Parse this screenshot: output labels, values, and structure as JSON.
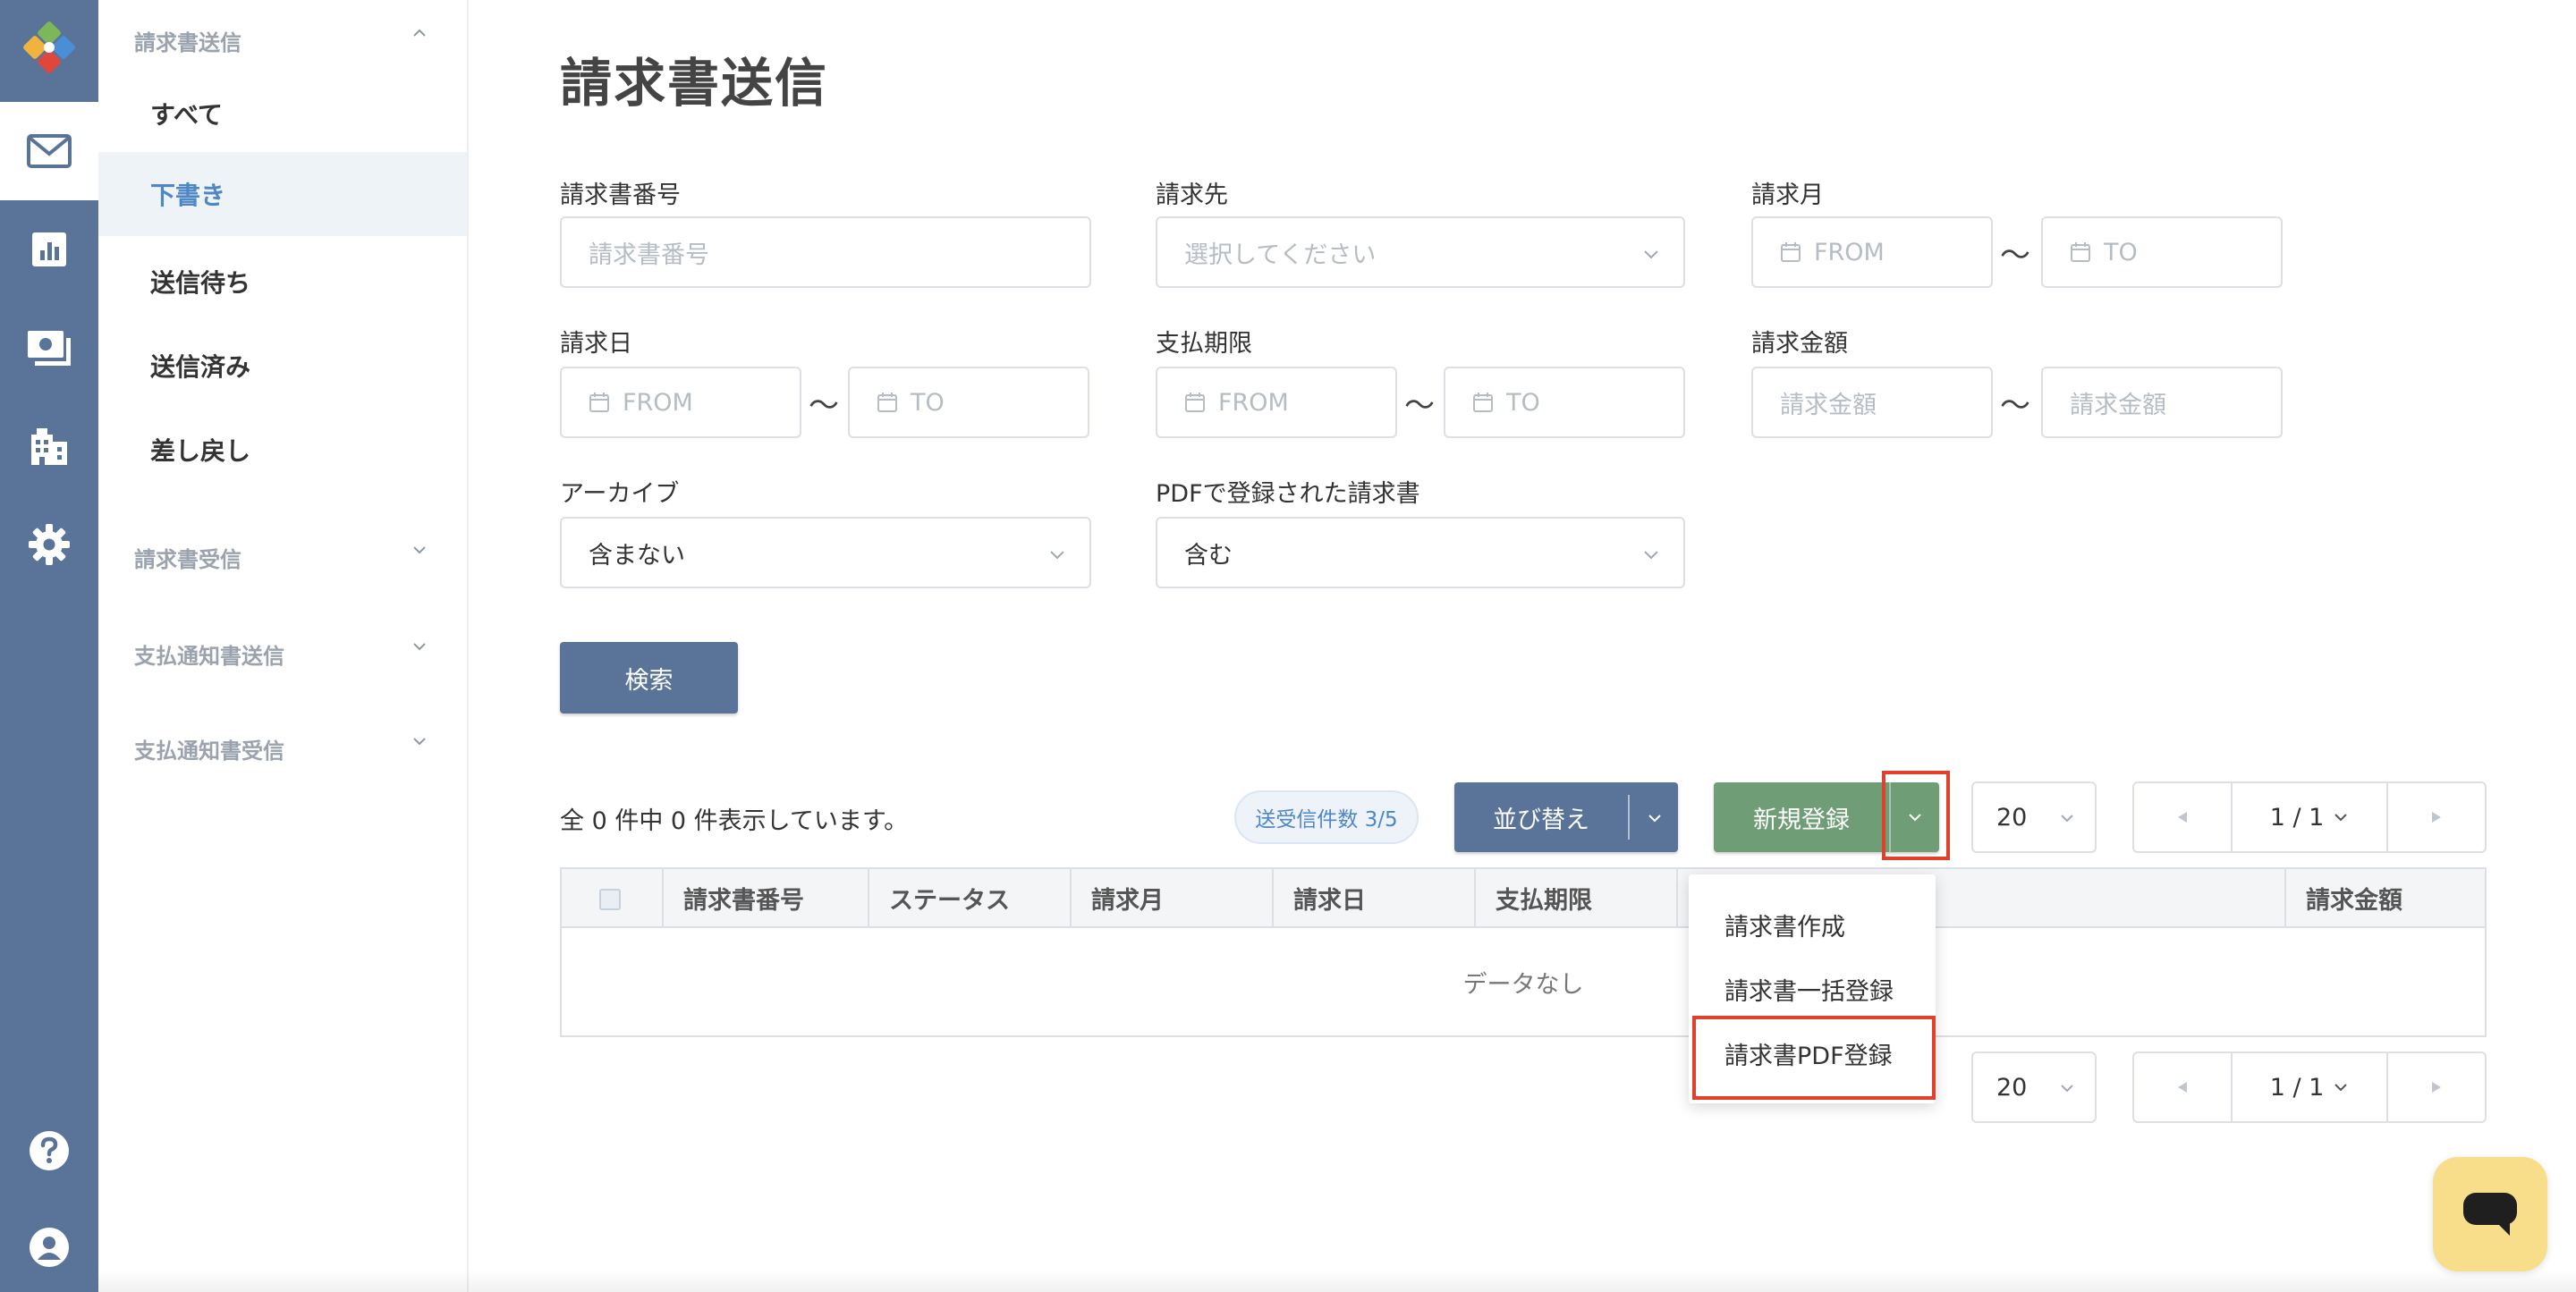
{
  "rail": {
    "logo_icon": "puzzle-logo-icon",
    "items": [
      {
        "icon": "mail-icon",
        "active": true
      },
      {
        "icon": "chart-icon",
        "active": false
      },
      {
        "icon": "payment-icon",
        "active": false
      },
      {
        "icon": "building-icon",
        "active": false
      },
      {
        "icon": "gear-icon",
        "active": false
      }
    ],
    "bottom_items": [
      {
        "icon": "help-icon"
      },
      {
        "icon": "user-icon"
      }
    ]
  },
  "subnav": {
    "group_send": "請求書送信",
    "items": [
      {
        "label": "すべて",
        "active": false
      },
      {
        "label": "下書き",
        "active": true
      },
      {
        "label": "送信待ち",
        "active": false
      },
      {
        "label": "送信済み",
        "active": false
      },
      {
        "label": "差し戻し",
        "active": false
      }
    ],
    "group_receive": "請求書受信",
    "group_payment_send": "支払通知書送信",
    "group_payment_receive": "支払通知書受信"
  },
  "page": {
    "title": "請求書送信"
  },
  "filters": {
    "invoice_number": {
      "label": "請求書番号",
      "placeholder": "請求書番号"
    },
    "recipient": {
      "label": "請求先",
      "placeholder": "選択してください"
    },
    "billing_month": {
      "label": "請求月",
      "from": "FROM",
      "to": "TO"
    },
    "billing_date": {
      "label": "請求日",
      "from": "FROM",
      "to": "TO"
    },
    "due_date": {
      "label": "支払期限",
      "from": "FROM",
      "to": "TO"
    },
    "amount": {
      "label": "請求金額",
      "from": "請求金額",
      "to": "請求金額"
    },
    "archive": {
      "label": "アーカイブ",
      "value": "含まない"
    },
    "pdf_registered": {
      "label": "PDFで登録された請求書",
      "value": "含む"
    },
    "range_separator": "〜",
    "search_button": "検索"
  },
  "results": {
    "count_text": "全 0 件中 0 件表示しています。",
    "badge": "送受信件数 3/5",
    "sort_button": "並び替え",
    "new_button": "新規登録",
    "page_size": "20",
    "page_indicator": "1 / 1"
  },
  "table": {
    "columns": [
      "請求書番号",
      "ステータス",
      "請求月",
      "請求日",
      "支払期限",
      "",
      "請求金額"
    ],
    "empty": "データなし"
  },
  "new_menu": {
    "items": [
      "請求書作成",
      "請求書一括登録",
      "請求書PDF登録"
    ]
  },
  "colors": {
    "rail": "#5a7499",
    "primary_button": "#5a7499",
    "new_button": "#6e9d76",
    "active_nav_text": "#4f86c6",
    "highlight": "#e0412c",
    "chat": "#f8dd8a"
  }
}
